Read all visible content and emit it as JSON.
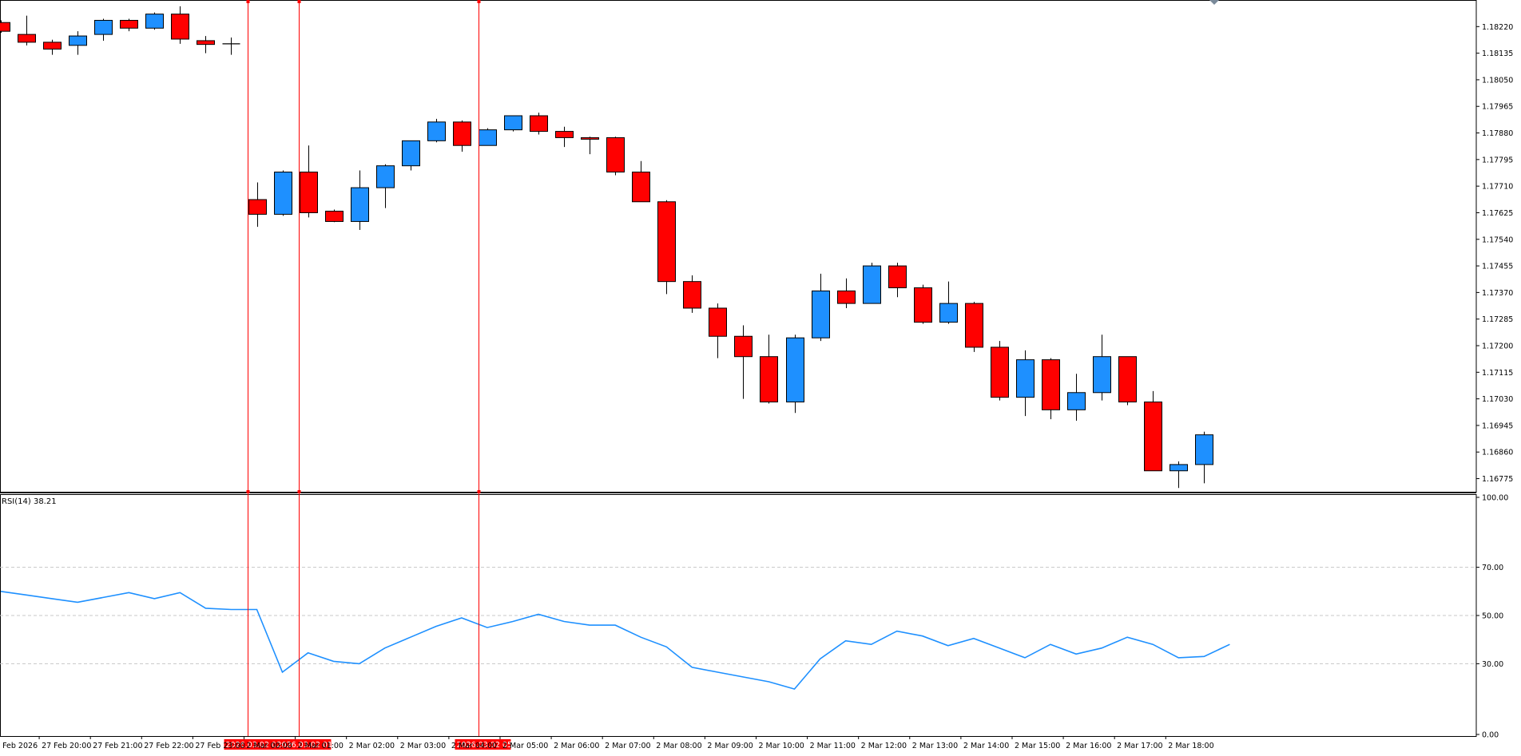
{
  "chart_data": [
    {
      "type": "candlestick",
      "panel": "price",
      "colors": {
        "bull": "#1E90FF",
        "bear": "#FF0000",
        "grid": "#c0c0c0",
        "axis": "#000000"
      },
      "ylim": [
        1.16733,
        1.18305
      ],
      "y_ticks": [
        "1.18220",
        "1.18135",
        "1.18050",
        "1.17965",
        "1.17880",
        "1.17795",
        "1.17710",
        "1.17625",
        "1.17540",
        "1.17455",
        "1.17370",
        "1.17285",
        "1.17200",
        "1.17115",
        "1.17030",
        "1.16945",
        "1.16860",
        "1.16775"
      ],
      "x_labels": [
        {
          "i": -0.5,
          "text": "27 Feb 2026"
        },
        {
          "i": 1.5,
          "text": "27 Feb 20:00"
        },
        {
          "i": 3.5,
          "text": "27 Feb 21:00"
        },
        {
          "i": 5.5,
          "text": "27 Feb 22:00"
        },
        {
          "i": 7.5,
          "text": "27 Feb 23:00"
        },
        {
          "i": 9.5,
          "text": "2 Mar 00:00"
        },
        {
          "i": 11.5,
          "text": "2 Mar 01:00"
        },
        {
          "i": 13.5,
          "text": "2 Mar 02:00"
        },
        {
          "i": 15.5,
          "text": "2 Mar 03:00"
        },
        {
          "i": 17.5,
          "text": "2 Mar 04:00"
        },
        {
          "i": 19.5,
          "text": "2 Mar 05:00"
        },
        {
          "i": 21.5,
          "text": "2 Mar 06:00"
        },
        {
          "i": 23.5,
          "text": "2 Mar 07:00"
        },
        {
          "i": 25.5,
          "text": "2 Mar 08:00"
        },
        {
          "i": 27.5,
          "text": "2 Mar 09:00"
        },
        {
          "i": 29.5,
          "text": "2 Mar 10:00"
        },
        {
          "i": 31.5,
          "text": "2 Mar 11:00"
        },
        {
          "i": 33.5,
          "text": "2 Mar 12:00"
        },
        {
          "i": 35.5,
          "text": "2 Mar 13:00"
        },
        {
          "i": 37.5,
          "text": "2 Mar 14:00"
        },
        {
          "i": 39.5,
          "text": "2 Mar 15:00"
        },
        {
          "i": 41.5,
          "text": "2 Mar 16:00"
        },
        {
          "i": 43.5,
          "text": "2 Mar 17:00"
        },
        {
          "i": 45.5,
          "text": "2 Mar 18:00"
        }
      ],
      "vlines": [
        {
          "i": 9.65,
          "label": "2026.03.02 00:30"
        },
        {
          "i": 11.65,
          "label": "2026.03.02 01:30"
        },
        {
          "i": 18.65,
          "label": "2026.03.02 05:00"
        }
      ],
      "candles": [
        {
          "o": 1.18233,
          "h": 1.1824,
          "l": 1.182,
          "c": 1.18205
        },
        {
          "o": 1.18195,
          "h": 1.18255,
          "l": 1.1816,
          "c": 1.1817
        },
        {
          "o": 1.1817,
          "h": 1.18178,
          "l": 1.1813,
          "c": 1.18148
        },
        {
          "o": 1.1816,
          "h": 1.18205,
          "l": 1.1813,
          "c": 1.1819
        },
        {
          "o": 1.18195,
          "h": 1.18245,
          "l": 1.18175,
          "c": 1.1824
        },
        {
          "o": 1.1824,
          "h": 1.18245,
          "l": 1.18205,
          "c": 1.18215
        },
        {
          "o": 1.18215,
          "h": 1.18265,
          "l": 1.1821,
          "c": 1.1826
        },
        {
          "o": 1.1826,
          "h": 1.18285,
          "l": 1.18165,
          "c": 1.1818
        },
        {
          "o": 1.18175,
          "h": 1.1819,
          "l": 1.18135,
          "c": 1.18163
        },
        {
          "o": 1.18165,
          "h": 1.18185,
          "l": 1.1813,
          "c": 1.18165
        },
        {
          "o": 1.17667,
          "h": 1.17722,
          "l": 1.1758,
          "c": 1.1762
        },
        {
          "o": 1.1762,
          "h": 1.1776,
          "l": 1.17615,
          "c": 1.17755
        },
        {
          "o": 1.17755,
          "h": 1.1784,
          "l": 1.1761,
          "c": 1.17625
        },
        {
          "o": 1.1763,
          "h": 1.17635,
          "l": 1.17595,
          "c": 1.17597
        },
        {
          "o": 1.17597,
          "h": 1.1776,
          "l": 1.1757,
          "c": 1.17705
        },
        {
          "o": 1.17705,
          "h": 1.1778,
          "l": 1.1764,
          "c": 1.17775
        },
        {
          "o": 1.17775,
          "h": 1.17855,
          "l": 1.1776,
          "c": 1.17855
        },
        {
          "o": 1.17855,
          "h": 1.17925,
          "l": 1.1785,
          "c": 1.17915
        },
        {
          "o": 1.17915,
          "h": 1.1792,
          "l": 1.1782,
          "c": 1.1784
        },
        {
          "o": 1.1784,
          "h": 1.17895,
          "l": 1.1784,
          "c": 1.1789
        },
        {
          "o": 1.1789,
          "h": 1.17935,
          "l": 1.17885,
          "c": 1.17935
        },
        {
          "o": 1.17935,
          "h": 1.17945,
          "l": 1.17875,
          "c": 1.17885
        },
        {
          "o": 1.17885,
          "h": 1.179,
          "l": 1.17835,
          "c": 1.17865
        },
        {
          "o": 1.17865,
          "h": 1.17868,
          "l": 1.17812,
          "c": 1.1786
        },
        {
          "o": 1.17865,
          "h": 1.17868,
          "l": 1.17745,
          "c": 1.17755
        },
        {
          "o": 1.17755,
          "h": 1.1779,
          "l": 1.1766,
          "c": 1.1766
        },
        {
          "o": 1.1766,
          "h": 1.17665,
          "l": 1.17365,
          "c": 1.17405
        },
        {
          "o": 1.17405,
          "h": 1.17425,
          "l": 1.17305,
          "c": 1.1732
        },
        {
          "o": 1.1732,
          "h": 1.17335,
          "l": 1.1716,
          "c": 1.1723
        },
        {
          "o": 1.1723,
          "h": 1.17265,
          "l": 1.1703,
          "c": 1.17165
        },
        {
          "o": 1.17165,
          "h": 1.17235,
          "l": 1.17015,
          "c": 1.1702
        },
        {
          "o": 1.1702,
          "h": 1.17235,
          "l": 1.16985,
          "c": 1.17225
        },
        {
          "o": 1.17225,
          "h": 1.1743,
          "l": 1.17215,
          "c": 1.17375
        },
        {
          "o": 1.17375,
          "h": 1.17415,
          "l": 1.1732,
          "c": 1.17335
        },
        {
          "o": 1.17335,
          "h": 1.17465,
          "l": 1.17335,
          "c": 1.17455
        },
        {
          "o": 1.17455,
          "h": 1.17465,
          "l": 1.17355,
          "c": 1.17385
        },
        {
          "o": 1.17385,
          "h": 1.17395,
          "l": 1.1727,
          "c": 1.17275
        },
        {
          "o": 1.17275,
          "h": 1.17405,
          "l": 1.1727,
          "c": 1.17335
        },
        {
          "o": 1.17335,
          "h": 1.1734,
          "l": 1.1718,
          "c": 1.17195
        },
        {
          "o": 1.17195,
          "h": 1.17215,
          "l": 1.17025,
          "c": 1.17035
        },
        {
          "o": 1.17035,
          "h": 1.17185,
          "l": 1.16975,
          "c": 1.17155
        },
        {
          "o": 1.17155,
          "h": 1.1716,
          "l": 1.16965,
          "c": 1.16995
        },
        {
          "o": 1.16995,
          "h": 1.1711,
          "l": 1.1696,
          "c": 1.1705
        },
        {
          "o": 1.1705,
          "h": 1.17235,
          "l": 1.17025,
          "c": 1.17165
        },
        {
          "o": 1.17165,
          "h": 1.17165,
          "l": 1.1701,
          "c": 1.1702
        },
        {
          "o": 1.1702,
          "h": 1.17055,
          "l": 1.168,
          "c": 1.168
        },
        {
          "o": 1.168,
          "h": 1.1683,
          "l": 1.16745,
          "c": 1.1682
        },
        {
          "o": 1.1682,
          "h": 1.16925,
          "l": 1.1676,
          "c": 1.16915
        }
      ]
    },
    {
      "type": "line",
      "panel": "indicator",
      "title": "RSI(14) 38.21",
      "color": "#1E90FF",
      "ylim": [
        0,
        100
      ],
      "y_ticks": [
        "100.00",
        "70.00",
        "50.00",
        "30.00",
        "0.00"
      ],
      "levels": [
        70,
        50,
        30
      ],
      "values": [
        60.0,
        58.5,
        57.0,
        55.5,
        57.5,
        59.5,
        57.0,
        59.5,
        53.0,
        52.5,
        52.5,
        26.5,
        34.5,
        31.0,
        30.0,
        36.5,
        41.0,
        45.5,
        49.0,
        45.0,
        47.5,
        50.5,
        47.5,
        46.0,
        46.0,
        41.0,
        37.0,
        28.5,
        26.5,
        24.5,
        22.5,
        19.5,
        32.0,
        39.5,
        38.0,
        43.5,
        41.5,
        37.5,
        40.5,
        36.5,
        32.5,
        38.0,
        34.0,
        36.5,
        41.0,
        38.0,
        32.5,
        33.0,
        38.0
      ]
    }
  ]
}
